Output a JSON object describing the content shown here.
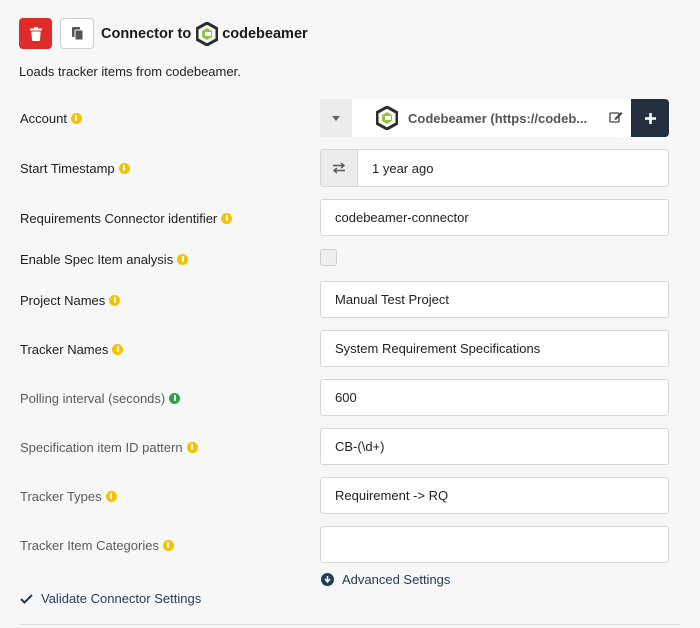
{
  "header": {
    "title": "Connector to",
    "brand_name": "codebeamer",
    "delete_icon": "trash-icon",
    "copy_icon": "copy-icon"
  },
  "description": "Loads tracker items from codebeamer.",
  "fields": {
    "account": {
      "label": "Account",
      "value": "Codebeamer (https://codeb..."
    },
    "start_timestamp": {
      "label": "Start Timestamp",
      "value": "1 year ago"
    },
    "req_connector_id": {
      "label": "Requirements Connector identifier",
      "value": "codebeamer-connector"
    },
    "enable_spec": {
      "label": "Enable Spec Item analysis",
      "checked": false
    },
    "project_names": {
      "label": "Project Names",
      "value": "Manual Test Project"
    },
    "tracker_names": {
      "label": "Tracker Names",
      "value": "System Requirement Specifications"
    },
    "polling_interval": {
      "label": "Polling interval (seconds)",
      "value": "600"
    },
    "spec_id_pattern": {
      "label": "Specification item ID pattern",
      "value": "CB-(\\d+)"
    },
    "tracker_types": {
      "label": "Tracker Types",
      "value": "Requirement -> RQ"
    },
    "tracker_item_categories": {
      "label": "Tracker Item Categories",
      "value": ""
    }
  },
  "advanced_settings_label": "Advanced Settings",
  "validate_label": "Validate Connector Settings",
  "colors": {
    "delete": "#e02b2b",
    "info_yellow": "#f4c200",
    "info_green": "#2da44e",
    "add_button": "#22303f",
    "link": "#1f3d5a",
    "brand_green": "#8dc63f"
  }
}
